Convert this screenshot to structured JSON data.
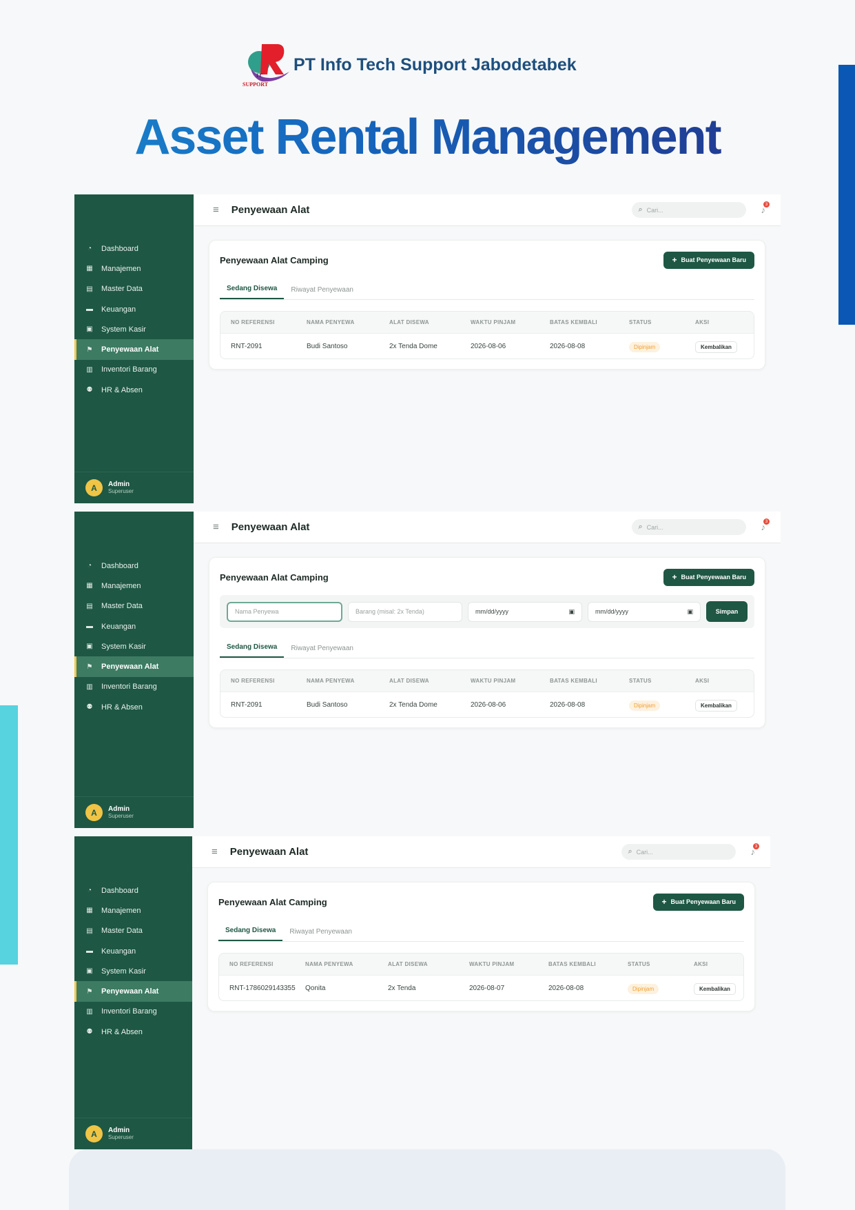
{
  "header": {
    "logo_text": "IT SUPPORT",
    "company": "PT Info Tech Support Jabodetabek",
    "title": "Asset Rental Management"
  },
  "sidebar": {
    "items": [
      {
        "label": "Dashboard",
        "icon": "pie-chart-icon"
      },
      {
        "label": "Manajemen",
        "icon": "calendar-check-icon"
      },
      {
        "label": "Master Data",
        "icon": "database-icon"
      },
      {
        "label": "Keuangan",
        "icon": "wallet-icon"
      },
      {
        "label": "System Kasir",
        "icon": "cash-register-icon"
      },
      {
        "label": "Penyewaan Alat",
        "icon": "hiking-icon",
        "active": true
      },
      {
        "label": "Inventori Barang",
        "icon": "boxes-icon"
      },
      {
        "label": "HR & Absen",
        "icon": "users-icon"
      }
    ],
    "user": {
      "initial": "A",
      "name": "Admin",
      "role": "Superuser"
    }
  },
  "topbar": {
    "title": "Penyewaan Alat",
    "search_placeholder": "Cari...",
    "notification_count": "3"
  },
  "card": {
    "title": "Penyewaan Alat Camping",
    "new_button": "Buat Penyewaan Baru",
    "tabs": [
      "Sedang Disewa",
      "Riwayat Penyewaan"
    ]
  },
  "form": {
    "name_placeholder": "Nama Penyewa",
    "item_placeholder": "Barang (misal: 2x Tenda)",
    "date_start": "mm/dd/yyyy",
    "date_end": "mm/dd/yyyy",
    "save_button": "Simpan"
  },
  "table": {
    "columns": [
      "NO REFERENSI",
      "NAMA PENYEWA",
      "ALAT DISEWA",
      "WAKTU PINJAM",
      "BATAS KEMBALI",
      "STATUS",
      "AKSI"
    ],
    "action_label": "Kembalikan"
  },
  "screens": [
    {
      "row": {
        "ref": "RNT-2091",
        "name": "Budi Santoso",
        "item": "2x Tenda Dome",
        "start": "2026-08-06",
        "end": "2026-08-08",
        "status": "Dipinjam"
      }
    },
    {
      "row": {
        "ref": "RNT-2091",
        "name": "Budi Santoso",
        "item": "2x Tenda Dome",
        "start": "2026-08-06",
        "end": "2026-08-08",
        "status": "Dipinjam"
      }
    },
    {
      "row": {
        "ref": "RNT-1786029143355",
        "name": "Qonita",
        "item": "2x Tenda",
        "start": "2026-08-07",
        "end": "2026-08-08",
        "status": "Dipinjam"
      }
    }
  ]
}
